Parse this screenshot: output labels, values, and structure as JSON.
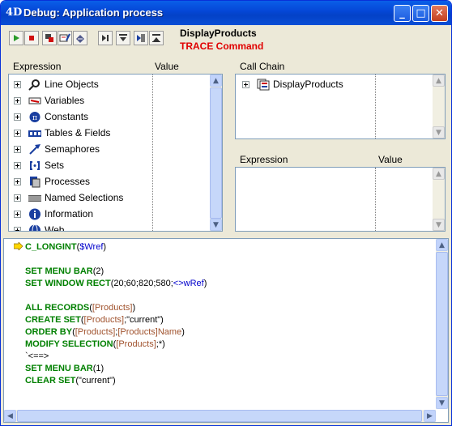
{
  "window": {
    "logo": "4D",
    "title": "Debug: Application process",
    "controls": {
      "minimize": "_",
      "maximize": "□",
      "close": "✕"
    }
  },
  "toolbar": {
    "buttons": [
      "run-icon",
      "stop-icon",
      "abort-icon",
      "edit-icon",
      "save-icon",
      "step-over-icon",
      "step-into-icon",
      "step-process-icon",
      "step-out-icon"
    ],
    "process_name": "DisplayProducts",
    "command_label": "TRACE Command"
  },
  "expression_panel": {
    "col_expression": "Expression",
    "col_value": "Value",
    "items": [
      {
        "label": "Line Objects",
        "icon": "magnifier-icon"
      },
      {
        "label": "Variables",
        "icon": "variable-icon"
      },
      {
        "label": "Constants",
        "icon": "pi-icon"
      },
      {
        "label": "Tables & Fields",
        "icon": "table-icon"
      },
      {
        "label": "Semaphores",
        "icon": "semaphore-icon"
      },
      {
        "label": "Sets",
        "icon": "set-icon"
      },
      {
        "label": "Processes",
        "icon": "process-icon"
      },
      {
        "label": "Named Selections",
        "icon": "selection-icon"
      },
      {
        "label": "Information",
        "icon": "info-icon"
      },
      {
        "label": "Web",
        "icon": "web-icon"
      }
    ]
  },
  "call_chain": {
    "header": "Call Chain",
    "items": [
      {
        "label": "DisplayProducts",
        "icon": "method-icon"
      }
    ]
  },
  "custom_watch": {
    "col_expression": "Expression",
    "col_value": "Value"
  },
  "source": {
    "lines": [
      {
        "parts": [
          {
            "t": "kw",
            "s": "C_LONGINT"
          },
          {
            "t": "lit",
            "s": "("
          },
          {
            "t": "var",
            "s": "$Wref"
          },
          {
            "t": "lit",
            "s": ")"
          }
        ],
        "current": true
      },
      {
        "parts": []
      },
      {
        "parts": [
          {
            "t": "kw",
            "s": "SET MENU BAR"
          },
          {
            "t": "lit",
            "s": "(2)"
          }
        ]
      },
      {
        "parts": [
          {
            "t": "kw",
            "s": "SET WINDOW RECT"
          },
          {
            "t": "lit",
            "s": "(20;60;820;580;"
          },
          {
            "t": "var",
            "s": "<>wRef"
          },
          {
            "t": "lit",
            "s": ")"
          }
        ]
      },
      {
        "parts": []
      },
      {
        "parts": [
          {
            "t": "kw",
            "s": "ALL RECORDS"
          },
          {
            "t": "lit",
            "s": "("
          },
          {
            "t": "tbl",
            "s": "[Products]"
          },
          {
            "t": "lit",
            "s": ")"
          }
        ]
      },
      {
        "parts": [
          {
            "t": "kw",
            "s": "CREATE SET"
          },
          {
            "t": "lit",
            "s": "("
          },
          {
            "t": "tbl",
            "s": "[Products]"
          },
          {
            "t": "lit",
            "s": ";\"current\")"
          }
        ]
      },
      {
        "parts": [
          {
            "t": "kw",
            "s": "ORDER BY"
          },
          {
            "t": "lit",
            "s": "("
          },
          {
            "t": "tbl",
            "s": "[Products]"
          },
          {
            "t": "lit",
            "s": ";"
          },
          {
            "t": "tbl",
            "s": "[Products]Name"
          },
          {
            "t": "lit",
            "s": ")"
          }
        ]
      },
      {
        "parts": [
          {
            "t": "kw",
            "s": "MODIFY SELECTION"
          },
          {
            "t": "lit",
            "s": "("
          },
          {
            "t": "tbl",
            "s": "[Products]"
          },
          {
            "t": "lit",
            "s": ";*)"
          }
        ]
      },
      {
        "parts": [
          {
            "t": "lit",
            "s": "  `<==>"
          }
        ]
      },
      {
        "parts": [
          {
            "t": "kw",
            "s": "SET MENU BAR"
          },
          {
            "t": "lit",
            "s": "(1)"
          }
        ]
      },
      {
        "parts": [
          {
            "t": "kw",
            "s": "CLEAR SET"
          },
          {
            "t": "lit",
            "s": "(\"current\")"
          }
        ]
      }
    ]
  }
}
